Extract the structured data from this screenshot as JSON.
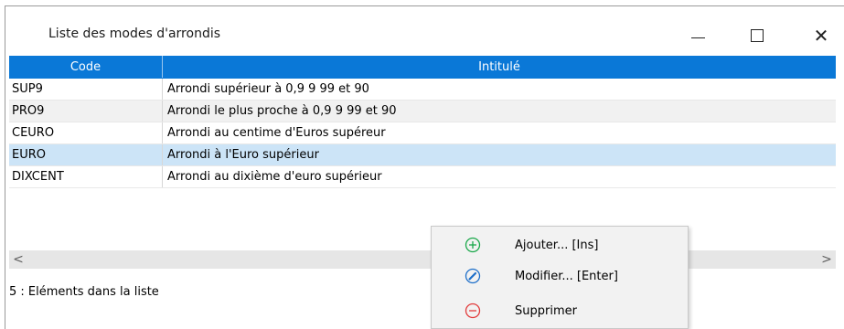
{
  "window": {
    "title": "Liste des modes d'arrondis",
    "controls": {
      "minimize": "—",
      "maximize": "☐",
      "close": "✕"
    }
  },
  "grid": {
    "columns": {
      "code": "Code",
      "intitule": "Intitulé"
    },
    "rows": [
      {
        "code": "SUP9",
        "intitule": "Arrondi supérieur à 0,9 9 99 et 90"
      },
      {
        "code": "PRO9",
        "intitule": "Arrondi le plus proche à 0,9 9 99 et 90"
      },
      {
        "code": "CEURO",
        "intitule": "Arrondi au centime d'Euros supéreur"
      },
      {
        "code": "EURO",
        "intitule": "Arrondi à l'Euro supérieur"
      },
      {
        "code": "DIXCENT",
        "intitule": "Arrondi au dixième d'euro supérieur"
      }
    ],
    "selected_row_index": 3
  },
  "scrollbar": {
    "left_arrow": "<",
    "right_arrow": ">"
  },
  "status": {
    "text": "5 : Eléments dans la liste"
  },
  "context_menu": {
    "items": [
      {
        "label": "Ajouter... [Ins]",
        "icon": "plus-circle-icon",
        "color": "#1aa84a"
      },
      {
        "label": "Modifier... [Enter]",
        "icon": "pencil-circle-icon",
        "color": "#1e6fc9"
      },
      {
        "label": "Supprimer",
        "icon": "minus-circle-icon",
        "color": "#e23b3b"
      }
    ]
  },
  "colors": {
    "header_bg": "#0a78d7",
    "selection_bg": "#cce4f7",
    "alt_row_bg": "#f1f1f1"
  }
}
